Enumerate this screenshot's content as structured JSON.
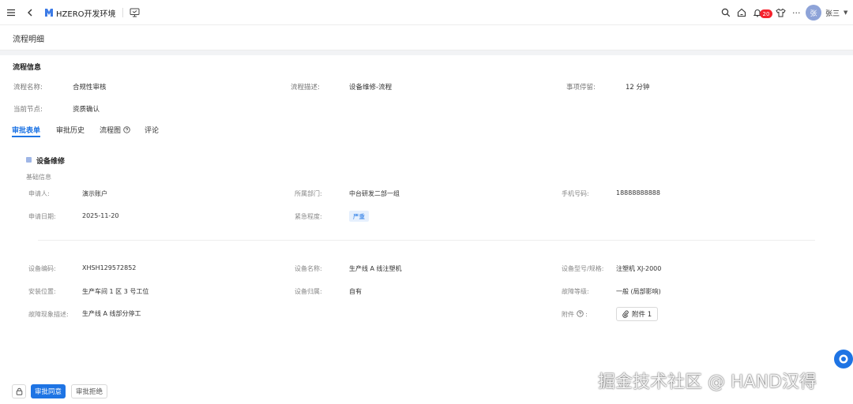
{
  "topbar": {
    "app_title": "HZERO开发环境",
    "notification_count": "20",
    "avatar_text": "张",
    "username": "张三"
  },
  "page": {
    "title": "流程明细"
  },
  "process_info": {
    "section_title": "流程信息",
    "name_label": "流程名称:",
    "name_value": "合规性审核",
    "desc_label": "流程描述:",
    "desc_value": "设备维修-流程",
    "stay_label": "事项停留:",
    "stay_value": "12 分钟",
    "node_label": "当前节点:",
    "node_value": "资质确认"
  },
  "tabs": [
    "审批表单",
    "审批历史",
    "流程图",
    "评论"
  ],
  "form": {
    "title": "设备维修",
    "basic_title": "基础信息",
    "applicant_label": "申请人:",
    "applicant_value": "演示账户",
    "dept_label": "所属部门:",
    "dept_value": "中台研发二部一组",
    "phone_label": "手机号码:",
    "phone_value": "18888888888",
    "date_label": "申请日期:",
    "date_value": "2025-11-20",
    "urgency_label": "紧急程度:",
    "urgency_value": "严重",
    "code_label": "设备编码:",
    "code_value": "XHSH129572852",
    "equip_name_label": "设备名称:",
    "equip_name_value": "生产线 A 线注塑机",
    "model_label": "设备型号/规格:",
    "model_value": "注塑机 XJ-2000",
    "location_label": "安装位置:",
    "location_value": "生产车间 1 区 3 号工位",
    "owner_label": "设备归属:",
    "owner_value": "自有",
    "level_label": "故障等级:",
    "level_value": "一般 (局部影响)",
    "fault_label": "故障现象描述:",
    "fault_value": "生产线 A 线部分停工",
    "attach_label": "附件",
    "attach_button": "附件 1"
  },
  "actions": {
    "approve": "审批同意",
    "reject": "审批拒绝"
  },
  "watermark": "掘金技术社区 @ HAND汉得",
  "colors": {
    "primary": "#1e74e4",
    "badge": "#f5222d"
  }
}
